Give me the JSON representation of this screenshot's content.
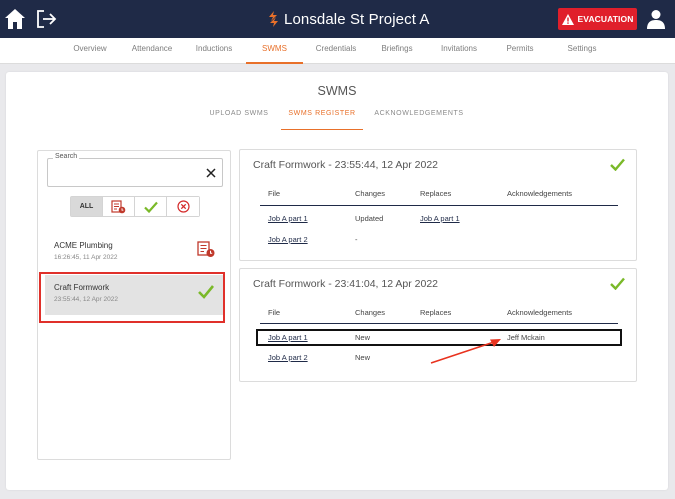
{
  "header": {
    "project_title": "Lonsdale St Project A",
    "evacuation_label": "EVACUATION",
    "colors": {
      "bar": "#1f2a47",
      "evacuation": "#e01f2b",
      "accent": "#e8702a",
      "check": "#7ab929"
    }
  },
  "nav": {
    "items": [
      "Overview",
      "Attendance",
      "Inductions",
      "SWMS",
      "Credentials",
      "Briefings",
      "Invitations",
      "Permits",
      "Settings"
    ],
    "active": "SWMS"
  },
  "page": {
    "title": "SWMS",
    "tabs": [
      "UPLOAD SWMS",
      "SWMS REGISTER",
      "ACKNOWLEDGEMENTS"
    ],
    "active_tab": "SWMS REGISTER"
  },
  "search": {
    "label": "Search",
    "value": ""
  },
  "filters": {
    "all_label": "ALL",
    "icons": [
      "document-pending-icon",
      "check-icon",
      "cross-circle-icon"
    ],
    "active": "ALL"
  },
  "list": [
    {
      "name": "ACME Plumbing",
      "time": "16:26:45, 11 Apr 2022",
      "status_icon": "document-pending-icon"
    },
    {
      "name": "Craft Formwork",
      "time": "23:55:44, 12 Apr 2022",
      "status_icon": "check-icon",
      "selected": true
    }
  ],
  "details": {
    "columns": [
      "File",
      "Changes",
      "Replaces",
      "Acknowledgements"
    ],
    "panels": [
      {
        "title": "Craft Formwork - 23:55:44, 12 Apr 2022",
        "status_icon": "check-icon",
        "rows": [
          {
            "file": "Job A part 1",
            "changes": "Updated",
            "replaces": "Job A part 1",
            "acknowledgements": ""
          },
          {
            "file": "Job A part 2",
            "changes": "-",
            "replaces": "",
            "acknowledgements": ""
          }
        ]
      },
      {
        "title": "Craft Formwork - 23:41:04, 12 Apr 2022",
        "status_icon": "check-icon",
        "rows": [
          {
            "file": "Job A part 1",
            "changes": "New",
            "replaces": "",
            "acknowledgements": "Jeff Mckain"
          },
          {
            "file": "Job A part 2",
            "changes": "New",
            "replaces": "",
            "acknowledgements": ""
          }
        ]
      }
    ]
  }
}
